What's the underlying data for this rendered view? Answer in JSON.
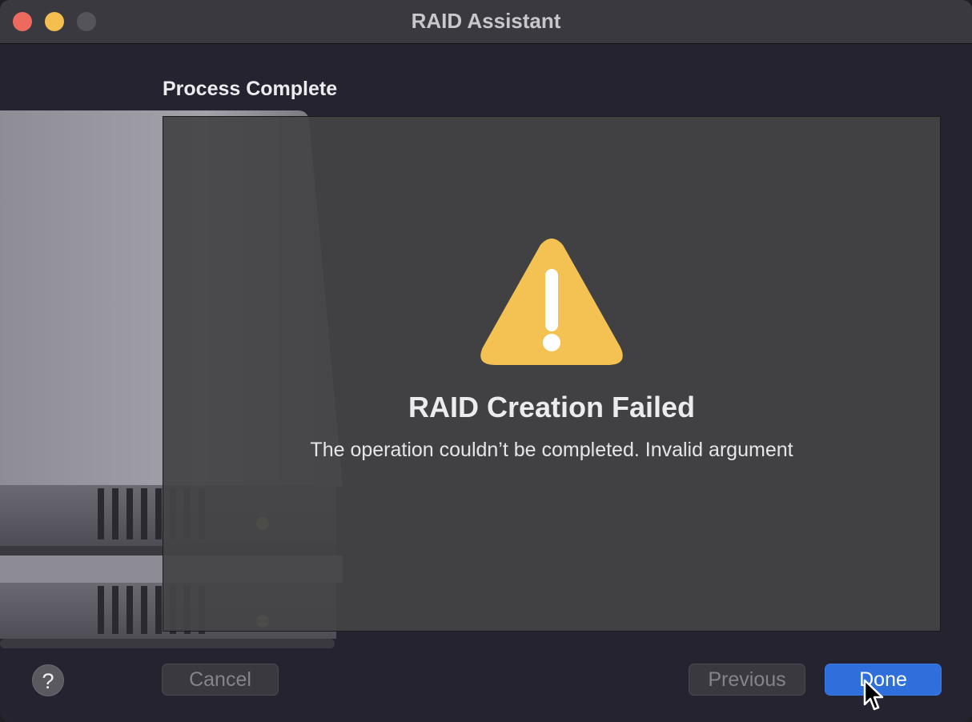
{
  "window": {
    "title": "RAID Assistant"
  },
  "step": {
    "heading": "Process Complete"
  },
  "result": {
    "icon": "warning-icon",
    "title": "RAID Creation Failed",
    "message": "The operation couldn’t be completed. Invalid argument"
  },
  "buttons": {
    "help": "?",
    "cancel": "Cancel",
    "previous": "Previous",
    "done": "Done"
  },
  "colors": {
    "warning": "#f4c153",
    "done_button": "#2f6fdc",
    "close": "#ed6a5e",
    "minimize": "#f4bf4f"
  }
}
